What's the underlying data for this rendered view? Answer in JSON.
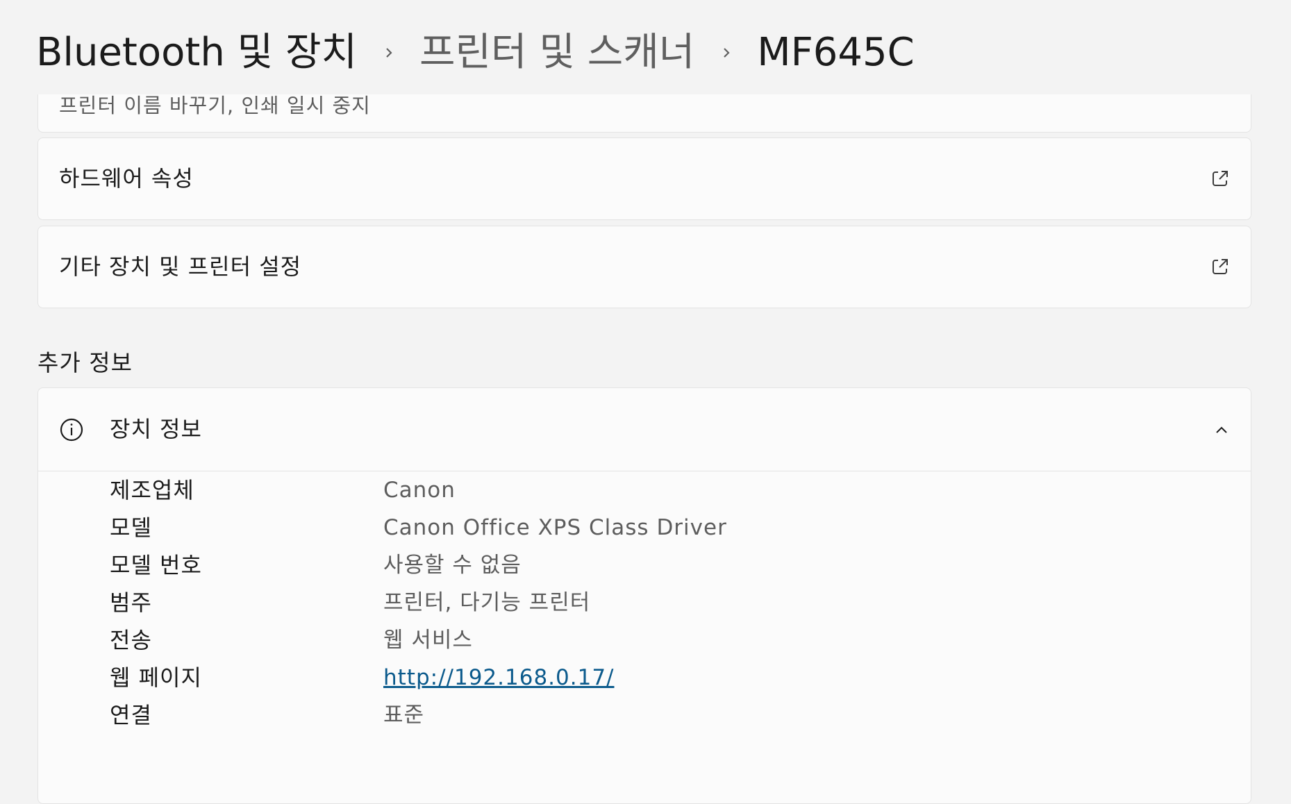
{
  "breadcrumb": {
    "root": "Bluetooth 및 장치",
    "middle": "프린터 및 스캐너",
    "current": "MF645C"
  },
  "top_card": {
    "subtitle": "프린터 이름 바꾸기, 인쇄 일시 중지"
  },
  "links": {
    "hardware": "하드웨어 속성",
    "other_devices": "기타 장치 및 프린터 설정"
  },
  "additional_info": {
    "title": "추가 정보",
    "device_info": {
      "title": "장치 정보",
      "expanded": true,
      "rows": [
        {
          "key": "제조업체",
          "value": "Canon"
        },
        {
          "key": "모델",
          "value": "Canon Office XPS Class Driver"
        },
        {
          "key": "모델 번호",
          "value": "사용할 수 없음"
        },
        {
          "key": "범주",
          "value": "프린터, 다기능 프린터"
        },
        {
          "key": "전송",
          "value": "웹 서비스"
        },
        {
          "key": "웹 페이지",
          "value": "http://192.168.0.17/"
        },
        {
          "key": "연결",
          "value": "표준"
        }
      ]
    }
  },
  "icons": {
    "separator": "chevron-right-icon",
    "external": "open-external-icon",
    "info": "info-circle-icon",
    "collapse": "chevron-up-icon"
  },
  "colors": {
    "background": "#f3f3f3",
    "card": "#fbfbfb",
    "link": "#0b5a8c"
  }
}
